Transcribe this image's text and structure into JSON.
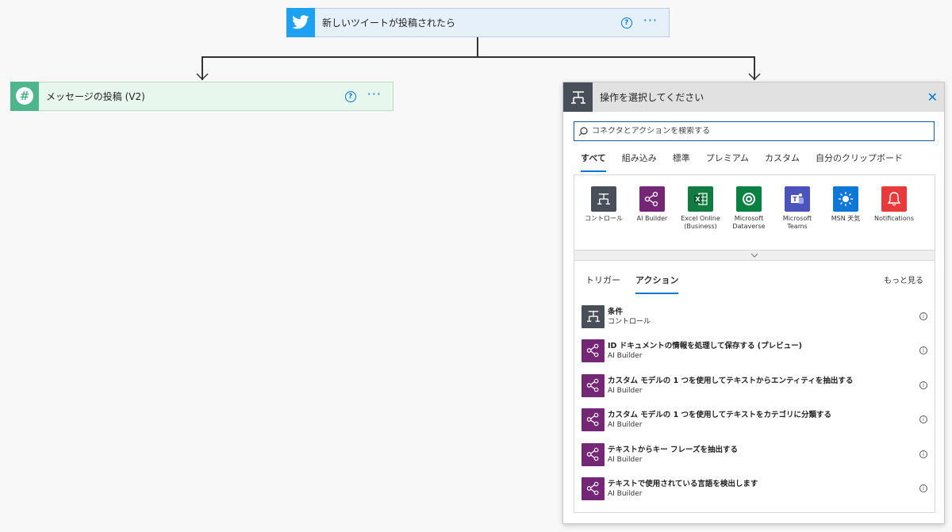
{
  "trigger_step": {
    "title": "新しいツイートが投稿されたら",
    "help": "?",
    "more": "···"
  },
  "left_step": {
    "title": "メッセージの投稿 (V2)",
    "help": "?",
    "more": "···"
  },
  "panel": {
    "title": "操作を選択してください",
    "close": "✕",
    "search_placeholder": "コネクタとアクションを検索する",
    "category_tabs": [
      "すべて",
      "組み込み",
      "標準",
      "プレミアム",
      "カスタム",
      "自分のクリップボード"
    ],
    "connectors": [
      {
        "label": "コントロール",
        "color": "#484f58",
        "icon": "control-icon"
      },
      {
        "label": "AI Builder",
        "color": "#742774",
        "icon": "ai-builder-icon"
      },
      {
        "label": "Excel Online (Business)",
        "color": "#107c41",
        "icon": "excel-icon"
      },
      {
        "label": "Microsoft Dataverse",
        "color": "#088142",
        "icon": "dataverse-icon"
      },
      {
        "label": "Microsoft Teams",
        "color": "#4b53bc",
        "icon": "teams-icon"
      },
      {
        "label": "MSN 天気",
        "color": "#0f78d7",
        "icon": "weather-icon"
      },
      {
        "label": "Notifications",
        "color": "#e83a3a",
        "icon": "bell-icon"
      }
    ],
    "sub_tabs": [
      "トリガー",
      "アクション"
    ],
    "see_more": "もっと見る",
    "actions": [
      {
        "name": "条件",
        "connector": "コントロール",
        "color": "#484f58",
        "icon": "control-icon"
      },
      {
        "name": "ID ドキュメントの情報を処理して保存する (プレビュー)",
        "connector": "AI Builder",
        "color": "#742774",
        "icon": "ai-builder-icon"
      },
      {
        "name": "カスタム モデルの 1 つを使用してテキストからエンティティを抽出する",
        "connector": "AI Builder",
        "color": "#742774",
        "icon": "ai-builder-icon"
      },
      {
        "name": "カスタム モデルの 1 つを使用してテキストをカテゴリに分類する",
        "connector": "AI Builder",
        "color": "#742774",
        "icon": "ai-builder-icon"
      },
      {
        "name": "テキストからキー フレーズを抽出する",
        "connector": "AI Builder",
        "color": "#742774",
        "icon": "ai-builder-icon"
      },
      {
        "name": "テキストで使用されている言語を検出します",
        "connector": "AI Builder",
        "color": "#742774",
        "icon": "ai-builder-icon"
      }
    ]
  }
}
